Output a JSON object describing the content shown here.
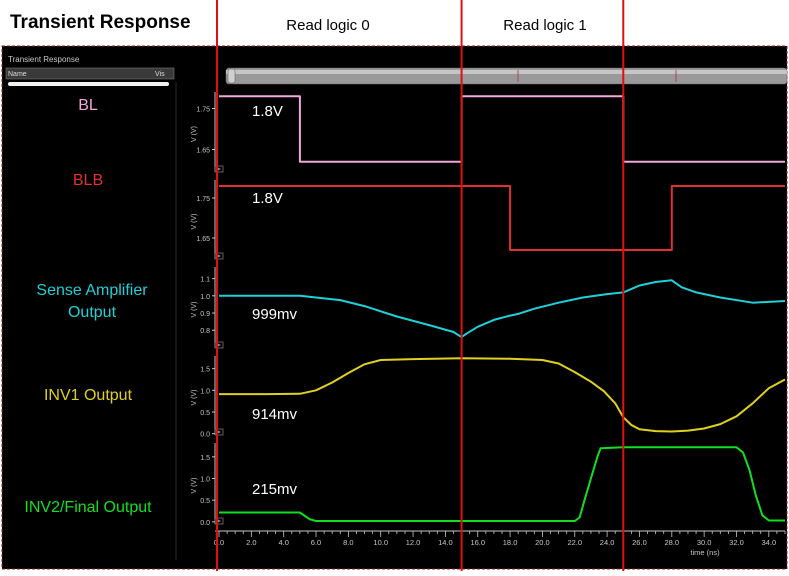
{
  "header": {
    "title": "Transient Response",
    "phase_labels": [
      "Read logic 0",
      "Read logic 1"
    ]
  },
  "viewer": {
    "panel_title": "Transient Response",
    "col_name": "Name",
    "col_vis": "Vis"
  },
  "colors": {
    "bg": "#000000",
    "BL": "#f0a8d8",
    "BLB": "#e03030",
    "SA": "#20d0d8",
    "INV1": "#e0d020",
    "INV2": "#10e020",
    "divider": "#e01010",
    "axis": "#c8c8c8"
  },
  "chart_data": {
    "type": "line",
    "xlabel": "time (ns)",
    "xlim": [
      0,
      35
    ],
    "xticks": [
      "0.0",
      "2.0",
      "4.0",
      "6.0",
      "8.0",
      "10.0",
      "12.0",
      "14.0",
      "16.0",
      "18.0",
      "20.0",
      "22.0",
      "24.0",
      "26.0",
      "28.0",
      "30.0",
      "32.0",
      "34.0"
    ],
    "markers_ns": [
      15.0,
      25.0
    ],
    "panels": [
      {
        "key": "BL",
        "label": "BL",
        "annotation": "1.8V",
        "ylabel": "V (V)",
        "ylim": [
          1.6,
          1.8
        ],
        "yticks": [
          "1.75",
          "1.65"
        ],
        "ytick_values": [
          1.75,
          1.65
        ],
        "points": [
          [
            0,
            1.78
          ],
          [
            5,
            1.78
          ],
          [
            5,
            1.62
          ],
          [
            15,
            1.62
          ],
          [
            15,
            1.78
          ],
          [
            25,
            1.78
          ],
          [
            25,
            1.62
          ],
          [
            35,
            1.62
          ]
        ]
      },
      {
        "key": "BLB",
        "label": "BLB",
        "annotation": "1.8V",
        "ylabel": "V (V)",
        "ylim": [
          1.6,
          1.8
        ],
        "yticks": [
          "1.75",
          "1.65"
        ],
        "ytick_values": [
          1.75,
          1.65
        ],
        "points": [
          [
            0,
            1.78
          ],
          [
            18,
            1.78
          ],
          [
            18,
            1.62
          ],
          [
            28,
            1.62
          ],
          [
            28,
            1.78
          ],
          [
            35,
            1.78
          ]
        ]
      },
      {
        "key": "SA",
        "label": "Sense Amplifier Output",
        "annotation": "999mv",
        "ylabel": "V (V)",
        "ylim": [
          0.72,
          1.15
        ],
        "yticks": [
          "1.1",
          "1.0",
          "0.9",
          "0.8"
        ],
        "ytick_values": [
          1.1,
          1.0,
          0.9,
          0.8
        ],
        "points": [
          [
            0,
            1.0
          ],
          [
            2,
            1.0
          ],
          [
            5,
            1.0
          ],
          [
            6,
            0.99
          ],
          [
            7.5,
            0.975
          ],
          [
            9,
            0.94
          ],
          [
            11,
            0.88
          ],
          [
            13,
            0.83
          ],
          [
            14.5,
            0.79
          ],
          [
            15,
            0.76
          ],
          [
            15.3,
            0.78
          ],
          [
            16,
            0.82
          ],
          [
            17,
            0.86
          ],
          [
            18,
            0.885
          ],
          [
            18.5,
            0.895
          ],
          [
            19.5,
            0.925
          ],
          [
            21,
            0.96
          ],
          [
            22.5,
            0.99
          ],
          [
            24,
            1.01
          ],
          [
            25,
            1.02
          ],
          [
            26,
            1.06
          ],
          [
            27,
            1.08
          ],
          [
            28,
            1.09
          ],
          [
            28.6,
            1.05
          ],
          [
            29.5,
            1.02
          ],
          [
            31,
            0.99
          ],
          [
            33,
            0.96
          ],
          [
            35,
            0.97
          ]
        ]
      },
      {
        "key": "INV1",
        "label": "INV1 Output",
        "annotation": "914mv",
        "ylabel": "V (V)",
        "ylim": [
          -0.1,
          1.7
        ],
        "yticks": [
          "1.5",
          "1.0",
          "0.5",
          "0.0"
        ],
        "ytick_values": [
          1.5,
          1.0,
          0.5,
          0.0
        ],
        "points": [
          [
            0,
            0.914
          ],
          [
            3,
            0.914
          ],
          [
            5,
            0.92
          ],
          [
            6,
            1.0
          ],
          [
            7,
            1.18
          ],
          [
            8,
            1.4
          ],
          [
            9,
            1.6
          ],
          [
            10,
            1.7
          ],
          [
            12,
            1.72
          ],
          [
            15,
            1.74
          ],
          [
            18,
            1.73
          ],
          [
            20,
            1.7
          ],
          [
            21,
            1.62
          ],
          [
            22,
            1.42
          ],
          [
            23,
            1.2
          ],
          [
            23.8,
            0.98
          ],
          [
            24.5,
            0.7
          ],
          [
            25,
            0.38
          ],
          [
            25.5,
            0.2
          ],
          [
            26,
            0.1
          ],
          [
            27,
            0.06
          ],
          [
            28,
            0.05
          ],
          [
            29,
            0.07
          ],
          [
            30,
            0.12
          ],
          [
            31,
            0.22
          ],
          [
            32,
            0.4
          ],
          [
            33,
            0.7
          ],
          [
            34,
            1.05
          ],
          [
            35,
            1.25
          ]
        ]
      },
      {
        "key": "INV2",
        "label": "INV2/Final Output",
        "annotation": "215mv",
        "ylabel": "V (V)",
        "ylim": [
          -0.05,
          1.75
        ],
        "yticks": [
          "1.5",
          "1.0",
          "0.5",
          "0.0"
        ],
        "ytick_values": [
          1.5,
          1.0,
          0.5,
          0.0
        ],
        "points": [
          [
            0,
            0.215
          ],
          [
            5,
            0.215
          ],
          [
            5.6,
            0.06
          ],
          [
            6,
            0.02
          ],
          [
            15,
            0.02
          ],
          [
            22,
            0.02
          ],
          [
            22.3,
            0.1
          ],
          [
            22.6,
            0.5
          ],
          [
            23,
            1.0
          ],
          [
            23.4,
            1.5
          ],
          [
            23.6,
            1.7
          ],
          [
            25,
            1.72
          ],
          [
            30,
            1.72
          ],
          [
            32,
            1.72
          ],
          [
            32.4,
            1.6
          ],
          [
            32.8,
            1.2
          ],
          [
            33.2,
            0.6
          ],
          [
            33.6,
            0.15
          ],
          [
            34,
            0.03
          ],
          [
            35,
            0.03
          ]
        ]
      }
    ]
  }
}
